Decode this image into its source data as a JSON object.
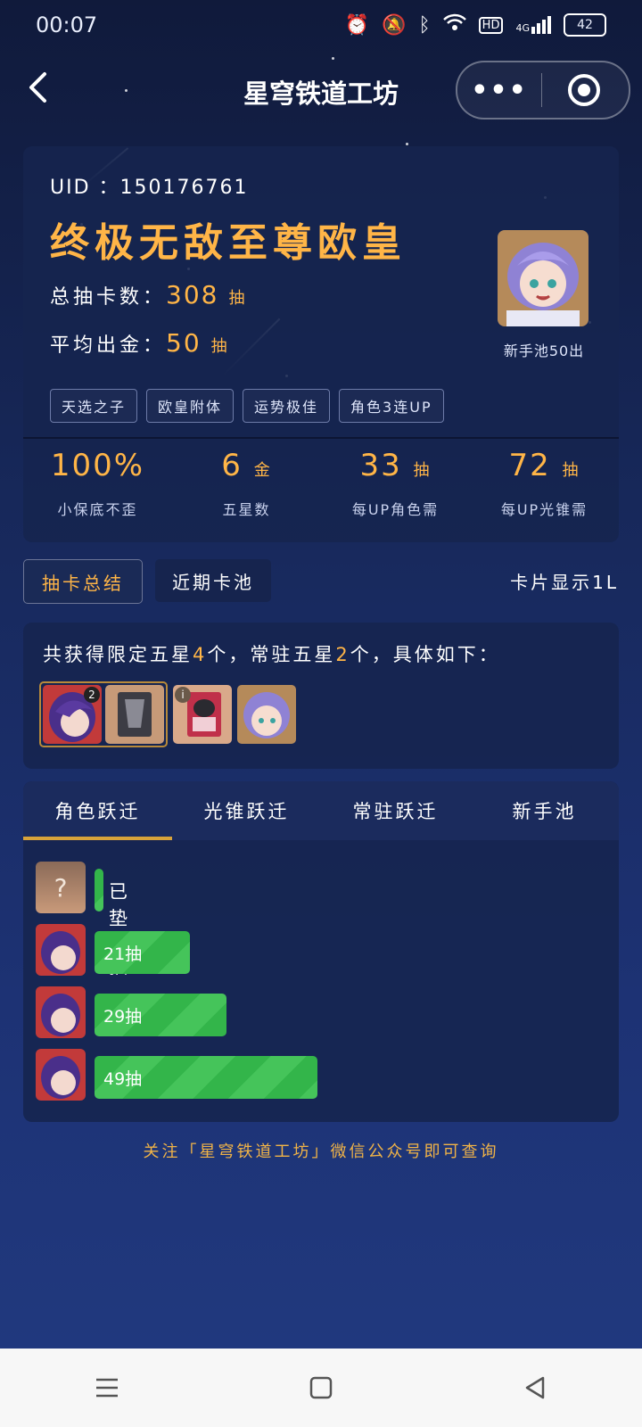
{
  "status_bar": {
    "time": "00:07",
    "icons": [
      "alarm-icon",
      "mute-icon",
      "bluetooth-icon",
      "wifi-icon",
      "hd-icon",
      "4g-signal-icon",
      "battery-icon"
    ],
    "hd": "HD",
    "network": "4G",
    "battery": "42"
  },
  "titlebar": {
    "title": "星穹铁道工坊",
    "more_icon": "•••",
    "capsule_icons": [
      "more-icon",
      "target-icon"
    ]
  },
  "profile": {
    "uid_label": "UID ：",
    "uid": "150176761",
    "rank_title": "终极无敌至尊欧皇",
    "total_label": "总抽卡数：",
    "total_value": "308",
    "total_unit": "抽",
    "avg_label": "平均出金：",
    "avg_value": "50",
    "avg_unit": "抽",
    "avatar_caption": "新手池50出",
    "tags": [
      "天选之子",
      "欧皇附体",
      "运势极佳",
      "角色3连UP"
    ]
  },
  "metrics": [
    {
      "value": "100%",
      "unit": "",
      "label": "小保底不歪"
    },
    {
      "value": "6",
      "unit": "金",
      "label": "五星数"
    },
    {
      "value": "33",
      "unit": "抽",
      "label": "每UP角色需"
    },
    {
      "value": "72",
      "unit": "抽",
      "label": "每UP光锥需"
    }
  ],
  "buttons": {
    "summary": "抽卡总结",
    "recent": "近期卡池",
    "display": "卡片显示1L"
  },
  "summary": {
    "prefix": "共获得限定五星",
    "limited": "4",
    "mid": "个，常驻五星",
    "standard": "2",
    "suffix": "个，具体如下：",
    "badge": "2"
  },
  "pool_tabs": [
    "角色跃迁",
    "光锥跃迁",
    "常驻跃迁",
    "新手池"
  ],
  "pity_rows": [
    {
      "label": "已垫2抽",
      "pulls": 2
    },
    {
      "label": "21抽",
      "pulls": 21
    },
    {
      "label": "29抽",
      "pulls": 29
    },
    {
      "label": "49抽",
      "pulls": 49
    }
  ],
  "unknown_mark": "?",
  "footer_note": "关注「星穹铁道工坊」微信公众号即可查询",
  "colors": {
    "accent": "#ffb547",
    "bar": "#33b54a",
    "tab_underline": "#d8a33a"
  }
}
